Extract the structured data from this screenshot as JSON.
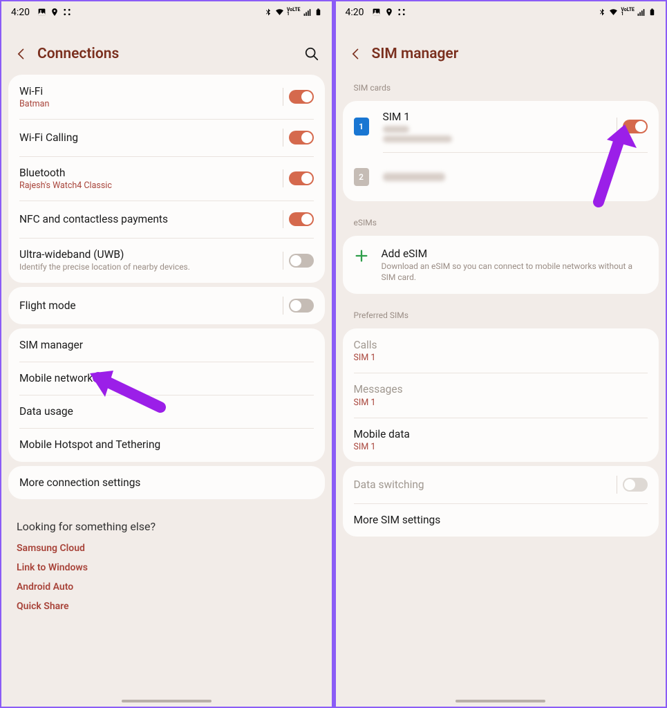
{
  "status": {
    "time": "4:20",
    "left_icons": [
      "image-icon",
      "pin-icon",
      "apps-icon"
    ],
    "right_icons": [
      "bluetooth-icon",
      "wifi-icon",
      "volte-icon",
      "signal-icon",
      "battery-icon"
    ]
  },
  "left": {
    "title": "Connections",
    "rows": {
      "wifi": {
        "title": "Wi-Fi",
        "sub": "Batman",
        "on": true
      },
      "wifi_calling": {
        "title": "Wi-Fi Calling",
        "on": true
      },
      "bluetooth": {
        "title": "Bluetooth",
        "sub": "Rajesh's Watch4 Classic",
        "on": true
      },
      "nfc": {
        "title": "NFC and contactless payments",
        "on": true
      },
      "uwb": {
        "title": "Ultra-wideband (UWB)",
        "desc": "Identify the precise location of nearby devices.",
        "on": false
      },
      "flight": {
        "title": "Flight mode",
        "on": false
      },
      "sim_manager": {
        "title": "SIM manager"
      },
      "mobile_networks": {
        "title": "Mobile networks"
      },
      "data_usage": {
        "title": "Data usage"
      },
      "hotspot": {
        "title": "Mobile Hotspot and Tethering"
      },
      "more": {
        "title": "More connection settings"
      }
    },
    "footer": {
      "heading": "Looking for something else?",
      "links": [
        "Samsung Cloud",
        "Link to Windows",
        "Android Auto",
        "Quick Share"
      ]
    }
  },
  "right": {
    "title": "SIM manager",
    "sections": {
      "sim_cards": "SIM cards",
      "esims": "eSIMs",
      "preferred": "Preferred SIMs"
    },
    "sim1": {
      "badge": "1",
      "title": "SIM 1",
      "on": true
    },
    "sim2": {
      "badge": "2"
    },
    "add_esim": {
      "title": "Add eSIM",
      "desc": "Download an eSIM so you can connect to mobile networks without a SIM card."
    },
    "calls": {
      "title": "Calls",
      "sub": "SIM 1"
    },
    "messages": {
      "title": "Messages",
      "sub": "SIM 1"
    },
    "mobile_data": {
      "title": "Mobile data",
      "sub": "SIM 1"
    },
    "data_switching": {
      "title": "Data switching",
      "on": false
    },
    "more_sim": {
      "title": "More SIM settings"
    }
  },
  "colors": {
    "accent": "#7a2f1e",
    "accent2": "#a8443a",
    "toggle_on": "#d5694d",
    "bg": "#f2ece8",
    "card": "#fdfcfb",
    "arrow": "#9b1fe8"
  }
}
